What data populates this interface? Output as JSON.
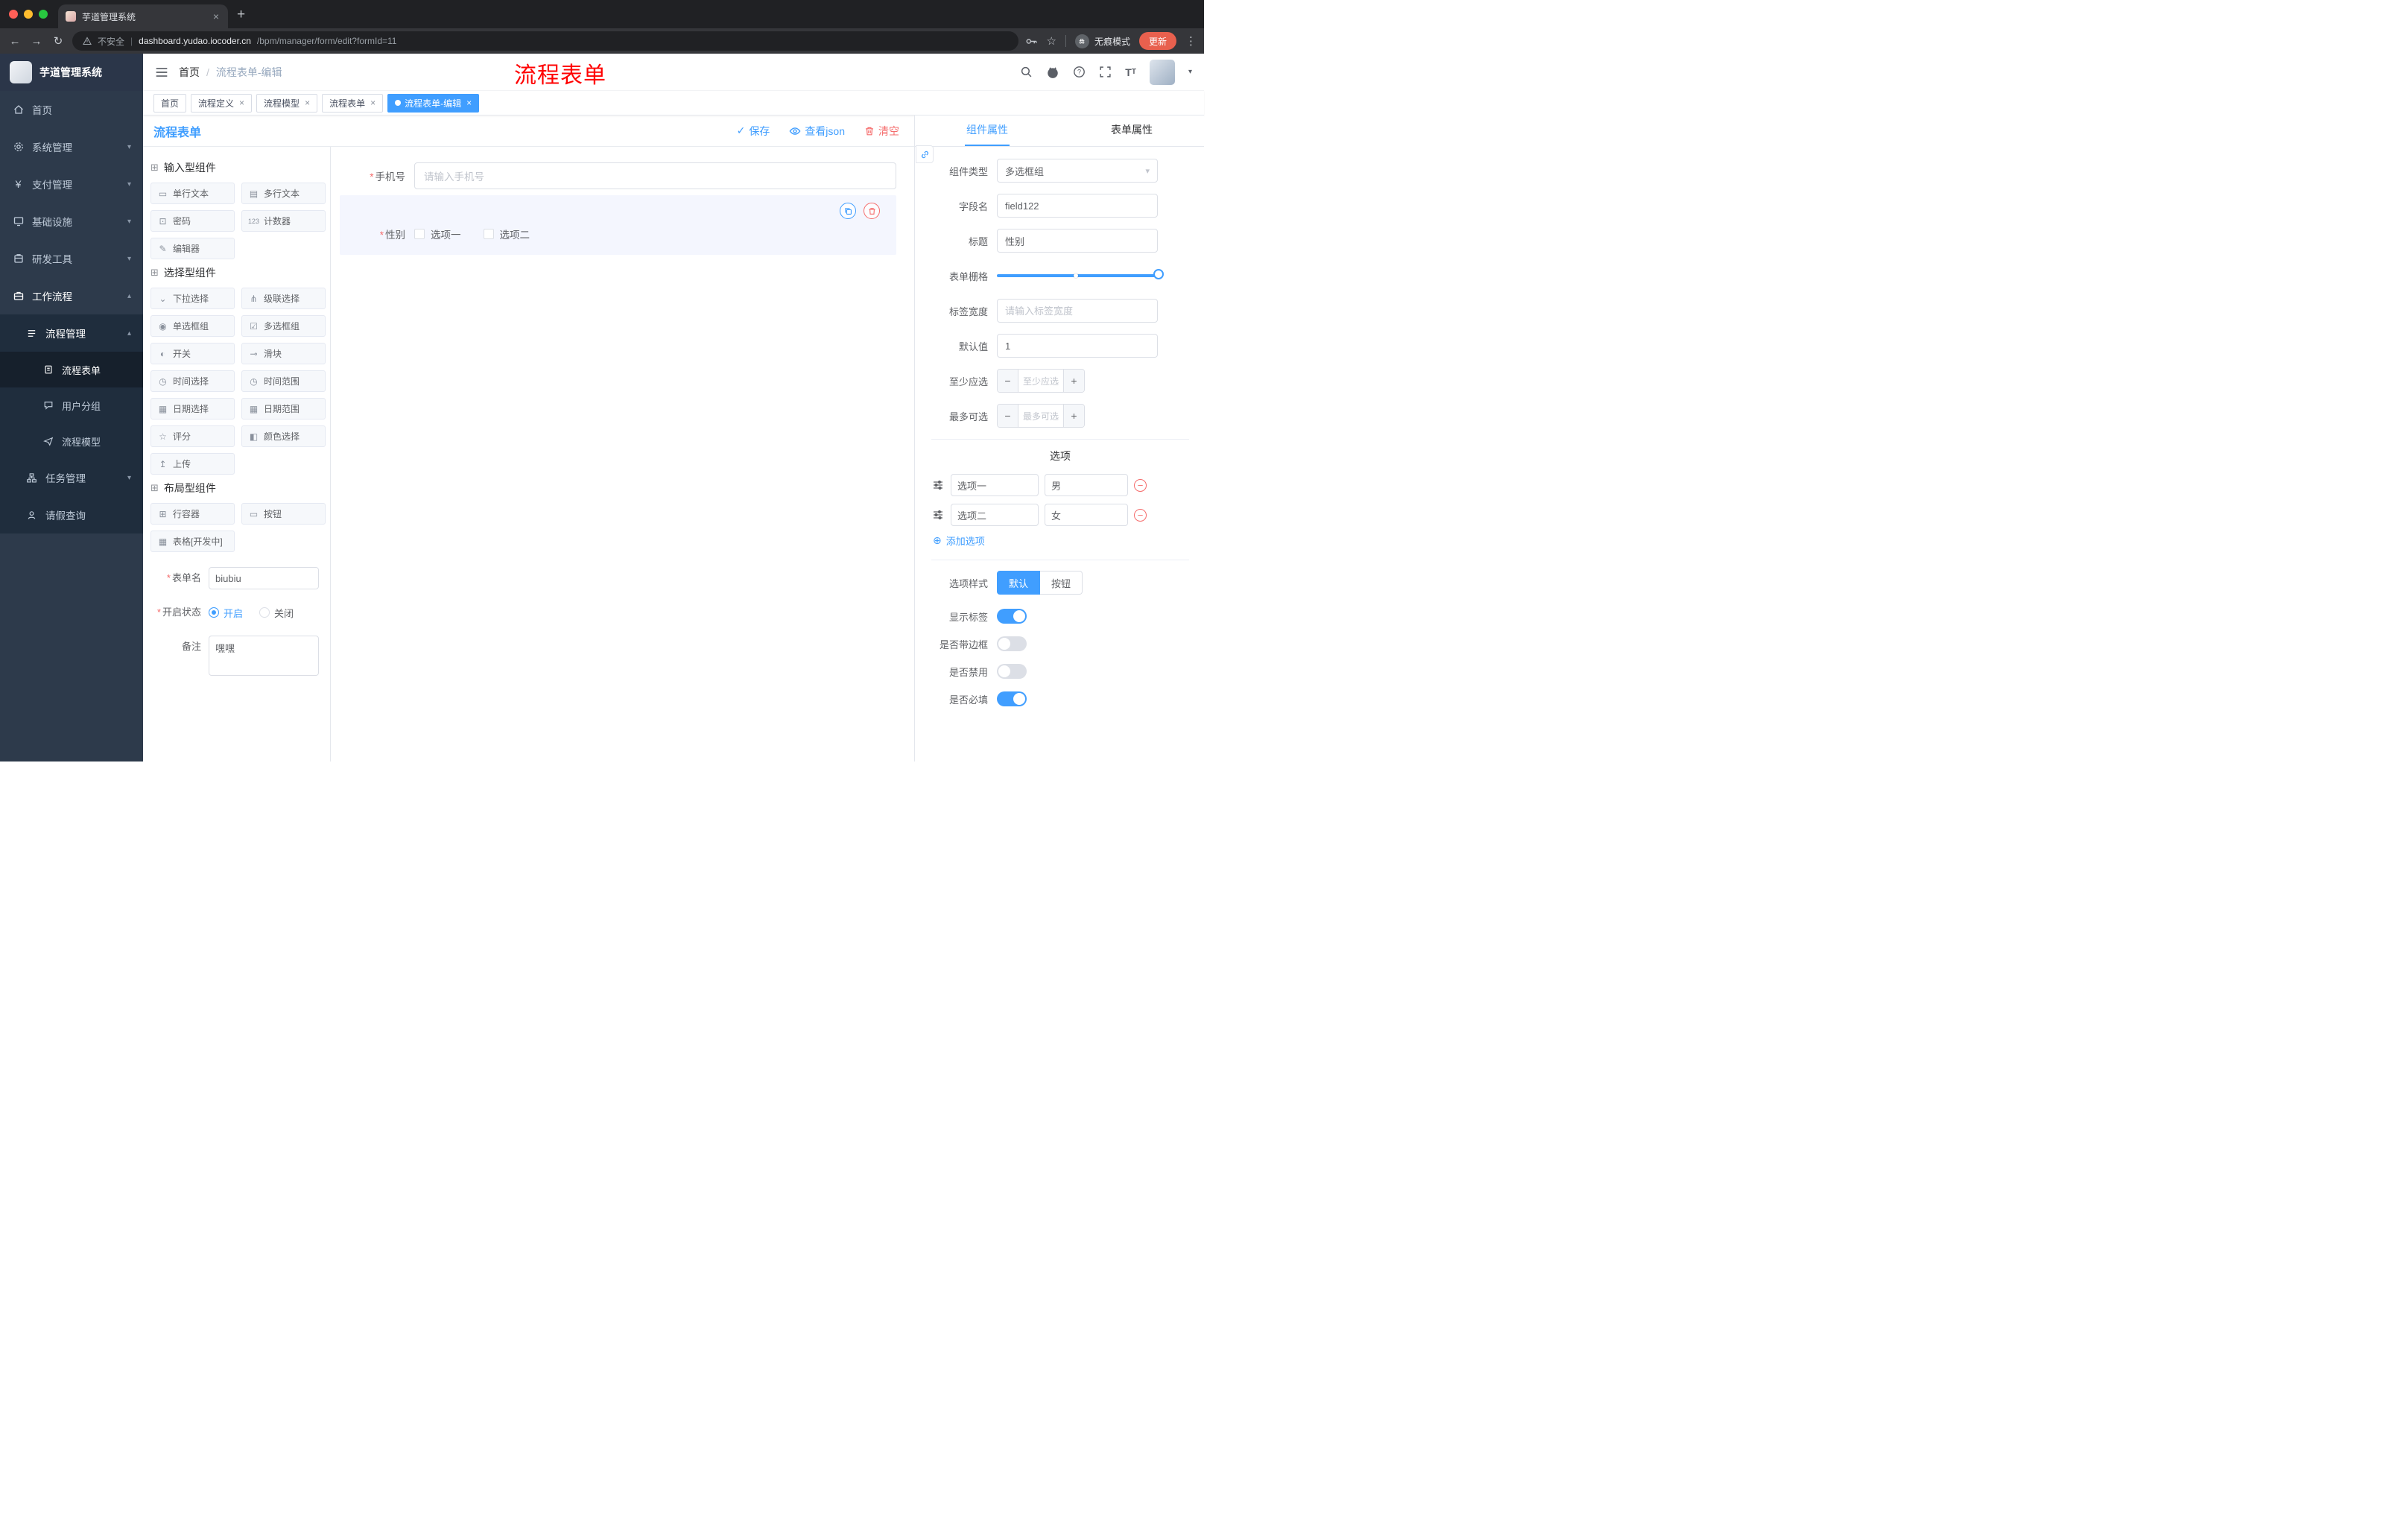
{
  "browser": {
    "tab_title": "芋道管理系统",
    "security_label": "不安全",
    "url_domain": "dashboard.yudao.iocoder.cn",
    "url_path": "/bpm/manager/form/edit?formId=11",
    "incognito_label": "无痕模式",
    "update_label": "更新"
  },
  "sidebar": {
    "logo_title": "芋道管理系统",
    "home": "首页",
    "system": "系统管理",
    "payment": "支付管理",
    "infra": "基础设施",
    "devtools": "研发工具",
    "workflow": "工作流程",
    "process_management": "流程管理",
    "process_form": "流程表单",
    "user_group": "用户分组",
    "process_model": "流程模型",
    "task_management": "任务管理",
    "leave_query": "请假查询"
  },
  "header": {
    "breadcrumb_home": "首页",
    "breadcrumb_current": "流程表单-编辑",
    "annotation": "流程表单"
  },
  "tags": [
    {
      "label": "首页",
      "active": false
    },
    {
      "label": "流程定义",
      "active": false
    },
    {
      "label": "流程模型",
      "active": false
    },
    {
      "label": "流程表单",
      "active": false
    },
    {
      "label": "流程表单-编辑",
      "active": true
    }
  ],
  "designer": {
    "title": "流程表单",
    "save_label": "保存",
    "view_json_label": "查看json",
    "clear_label": "清空",
    "groups": [
      {
        "title": "输入型组件",
        "items": [
          "单行文本",
          "多行文本",
          "密码",
          "计数器",
          "编辑器"
        ]
      },
      {
        "title": "选择型组件",
        "items": [
          "下拉选择",
          "级联选择",
          "单选框组",
          "多选框组",
          "开关",
          "滑块",
          "时间选择",
          "时间范围",
          "日期选择",
          "日期范围",
          "评分",
          "颜色选择",
          "上传"
        ]
      },
      {
        "title": "布局型组件",
        "items": [
          "行容器",
          "按钮",
          "表格[开发中]"
        ]
      }
    ],
    "meta": {
      "name_label": "表单名",
      "name_value": "biubiu",
      "status_label": "开启状态",
      "status_on": "开启",
      "status_on_selected": true,
      "status_off": "关闭",
      "remark_label": "备注",
      "remark_value": "嘿嘿"
    },
    "canvas": {
      "phone_label": "手机号",
      "phone_placeholder": "请输入手机号",
      "gender_label": "性别",
      "gender_option1": "选项一",
      "gender_option2": "选项二"
    }
  },
  "properties": {
    "tab_component": "组件属性",
    "tab_component_active": true,
    "tab_form": "表单属性",
    "component_type_label": "组件类型",
    "component_type_value": "多选框组",
    "field_name_label": "字段名",
    "field_name_value": "field122",
    "title_label": "标题",
    "title_value": "性别",
    "grid_label": "表单栅格",
    "label_width_label": "标签宽度",
    "label_width_placeholder": "请输入标签宽度",
    "default_label": "默认值",
    "default_value": "1",
    "min_label": "至少应选",
    "min_placeholder": "至少应选",
    "max_label": "最多可选",
    "max_placeholder": "最多可选",
    "options_title": "选项",
    "options": [
      {
        "label": "选项一",
        "value": "男"
      },
      {
        "label": "选项二",
        "value": "女"
      }
    ],
    "add_option_label": "添加选项",
    "style_label": "选项样式",
    "style_default": "默认",
    "style_default_selected": true,
    "style_button": "按钮",
    "toggles": [
      {
        "label": "显示标签",
        "on": true
      },
      {
        "label": "是否带边框",
        "on": false
      },
      {
        "label": "是否禁用",
        "on": false
      },
      {
        "label": "是否必填",
        "on": true
      }
    ]
  }
}
